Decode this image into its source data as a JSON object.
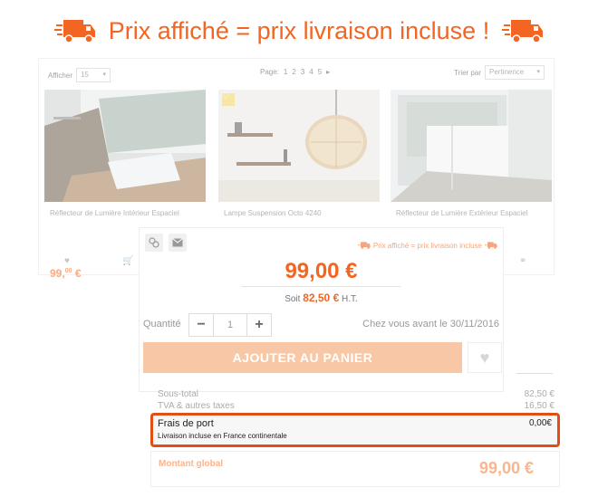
{
  "banner": {
    "text": "Prix affiché = prix livraison incluse !"
  },
  "listing": {
    "show_label": "Afficher",
    "show_value": "15",
    "page_label": "Page:",
    "pages": [
      "1",
      "2",
      "3",
      "4",
      "5",
      "▸"
    ],
    "sort_label": "Trier par",
    "sort_value": "Pertinence",
    "products": [
      {
        "name": "Réflecteur de Lumière Intérieur Espaciel",
        "price_main": "99,",
        "price_cents": "00",
        "currency": " €"
      },
      {
        "name": "Lampe Suspension Octo 4240"
      },
      {
        "name": "Réflecteur de Lumière Extérieur Espaciel"
      }
    ]
  },
  "product": {
    "tag": "Prix affiché = prix livraison incluse",
    "price": "99,00 €",
    "ht_prefix": "Soit",
    "ht_value": "82,50 €",
    "ht_suffix": "H.T.",
    "qty_label": "Quantité",
    "qty_minus": "−",
    "qty_value": "1",
    "qty_plus": "+",
    "delivery": "Chez vous avant le 30/11/2016",
    "add_to_cart": "AJOUTER AU PANIER"
  },
  "summary": {
    "subtotal_label": "Sous-total",
    "subtotal_value": "82,50 €",
    "tax_label": "TVA & autres taxes",
    "tax_value": "16,50 €",
    "shipping_label": "Frais de port",
    "shipping_value": "0,00€",
    "shipping_note": "Livraison incluse en France continentale",
    "total_label": "Montant global",
    "total_value": "99,00 €"
  },
  "colors": {
    "accent": "#f26522",
    "highlight_border": "#e24f16",
    "button": "#f8c8a6"
  }
}
